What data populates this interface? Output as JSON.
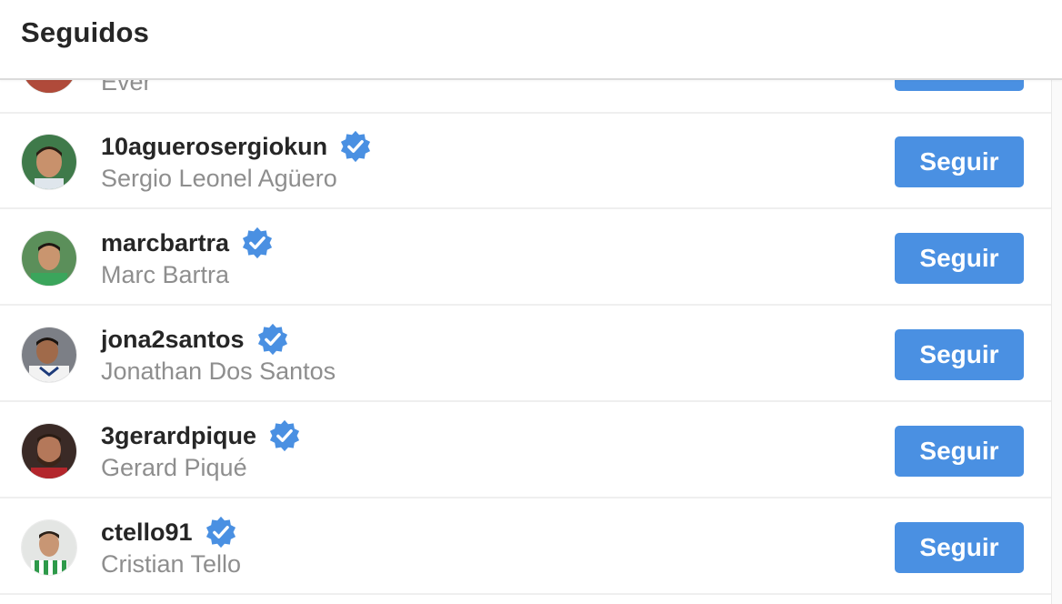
{
  "header": {
    "title": "Seguidos"
  },
  "rows": [
    {
      "username": "",
      "fullname": "Ever",
      "verified": false,
      "button": ""
    },
    {
      "username": "10aguerosergiokun",
      "fullname": "Sergio Leonel Agüero",
      "verified": true,
      "button": "Seguir"
    },
    {
      "username": "marcbartra",
      "fullname": "Marc Bartra",
      "verified": true,
      "button": "Seguir"
    },
    {
      "username": "jona2santos",
      "fullname": "Jonathan Dos Santos",
      "verified": true,
      "button": "Seguir"
    },
    {
      "username": "3gerardpique",
      "fullname": "Gerard Piqué",
      "verified": true,
      "button": "Seguir"
    },
    {
      "username": "ctello91",
      "fullname": "Cristian Tello",
      "verified": true,
      "button": "Seguir"
    }
  ],
  "colors": {
    "accent": "#4a90e2",
    "verified": "#3897f0",
    "username": "#262626",
    "fullname": "#8e8e8e",
    "divider": "#efefef"
  }
}
